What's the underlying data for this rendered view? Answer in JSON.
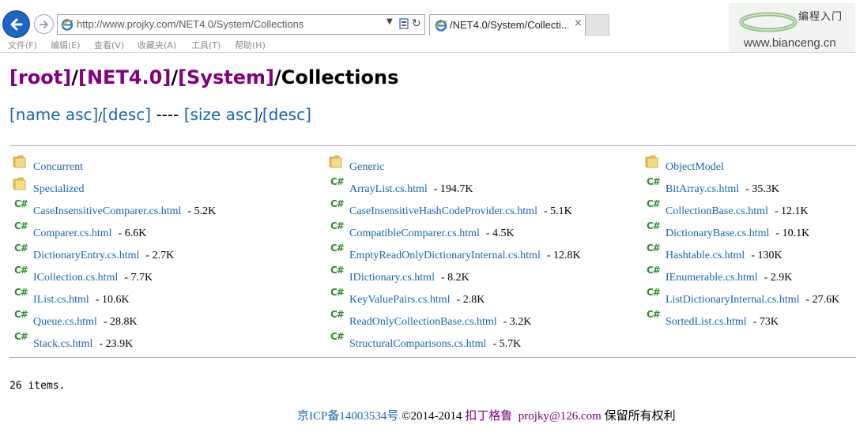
{
  "browser": {
    "url": "http://www.projky.com/NET4.0/System/Collections",
    "tab_title": "/NET4.0/System/Collecti...",
    "tab_close": "×",
    "menu": [
      "文件(F)",
      "编辑(E)",
      "查看(V)",
      "收藏夹(A)",
      "工具(T)",
      "帮助(H)"
    ],
    "watermark_cn": "编程入门",
    "watermark_url": "www.bianceng.cn"
  },
  "breadcrumb": {
    "root": "[root]",
    "sep1": "/",
    "net": "[NET4.0]",
    "sep2": "/",
    "system": "[System]",
    "sep3": "/",
    "current": "Collections"
  },
  "sort": {
    "name_asc": "[name asc]",
    "slash1": "/",
    "name_desc": "[desc]",
    "dashes": " ---- ",
    "size_asc": "[size asc]",
    "slash2": "/",
    "size_desc": "[desc]"
  },
  "columns": [
    [
      {
        "type": "folder",
        "name": "Concurrent",
        "size": ""
      },
      {
        "type": "folder",
        "name": "Specialized",
        "size": ""
      },
      {
        "type": "file",
        "name": "CaseInsensitiveComparer.cs.html",
        "size": "- 5.2K"
      },
      {
        "type": "file",
        "name": "Comparer.cs.html",
        "size": "- 6.6K"
      },
      {
        "type": "file",
        "name": "DictionaryEntry.cs.html",
        "size": "- 2.7K"
      },
      {
        "type": "file",
        "name": "ICollection.cs.html",
        "size": "- 7.7K"
      },
      {
        "type": "file",
        "name": "IList.cs.html",
        "size": "- 10.6K"
      },
      {
        "type": "file",
        "name": "Queue.cs.html",
        "size": "- 28.8K"
      },
      {
        "type": "file",
        "name": "Stack.cs.html",
        "size": "- 23.9K"
      }
    ],
    [
      {
        "type": "folder",
        "name": "Generic",
        "size": ""
      },
      {
        "type": "file",
        "name": "ArrayList.cs.html",
        "size": "- 194.7K"
      },
      {
        "type": "file",
        "name": "CaseInsensitiveHashCodeProvider.cs.html",
        "size": "- 5.1K"
      },
      {
        "type": "file",
        "name": "CompatibleComparer.cs.html",
        "size": "- 4.5K"
      },
      {
        "type": "file",
        "name": "EmptyReadOnlyDictionaryInternal.cs.html",
        "size": "- 12.8K"
      },
      {
        "type": "file",
        "name": "IDictionary.cs.html",
        "size": "- 8.2K"
      },
      {
        "type": "file",
        "name": "KeyValuePairs.cs.html",
        "size": "- 2.8K"
      },
      {
        "type": "file",
        "name": "ReadOnlyCollectionBase.cs.html",
        "size": "- 3.2K"
      },
      {
        "type": "file",
        "name": "StructuralComparisons.cs.html",
        "size": "- 5.7K"
      }
    ],
    [
      {
        "type": "folder",
        "name": "ObjectModel",
        "size": ""
      },
      {
        "type": "file",
        "name": "BitArray.cs.html",
        "size": "- 35.3K"
      },
      {
        "type": "file",
        "name": "CollectionBase.cs.html",
        "size": "- 12.1K"
      },
      {
        "type": "file",
        "name": "DictionaryBase.cs.html",
        "size": "- 10.1K"
      },
      {
        "type": "file",
        "name": "Hashtable.cs.html",
        "size": "- 130K"
      },
      {
        "type": "file",
        "name": "IEnumerable.cs.html",
        "size": "- 2.9K"
      },
      {
        "type": "file",
        "name": "ListDictionaryInternal.cs.html",
        "size": "- 27.6K"
      },
      {
        "type": "file",
        "name": "SortedList.cs.html",
        "size": "- 73K"
      }
    ]
  ],
  "item_count": "26 items.",
  "footer": {
    "icp": "京ICP备14003534号",
    "copyright": " ©2014-2014 ",
    "owner": "扣丁格鲁",
    "email": "projky@126.com",
    "rights": "保留所有权利"
  },
  "icons": {
    "folder": "folder-icon",
    "file": "csharp-file-icon"
  },
  "colors": {
    "link": "#1a64b4",
    "visited": "#800080",
    "cs_green": "#2f8f2f"
  }
}
